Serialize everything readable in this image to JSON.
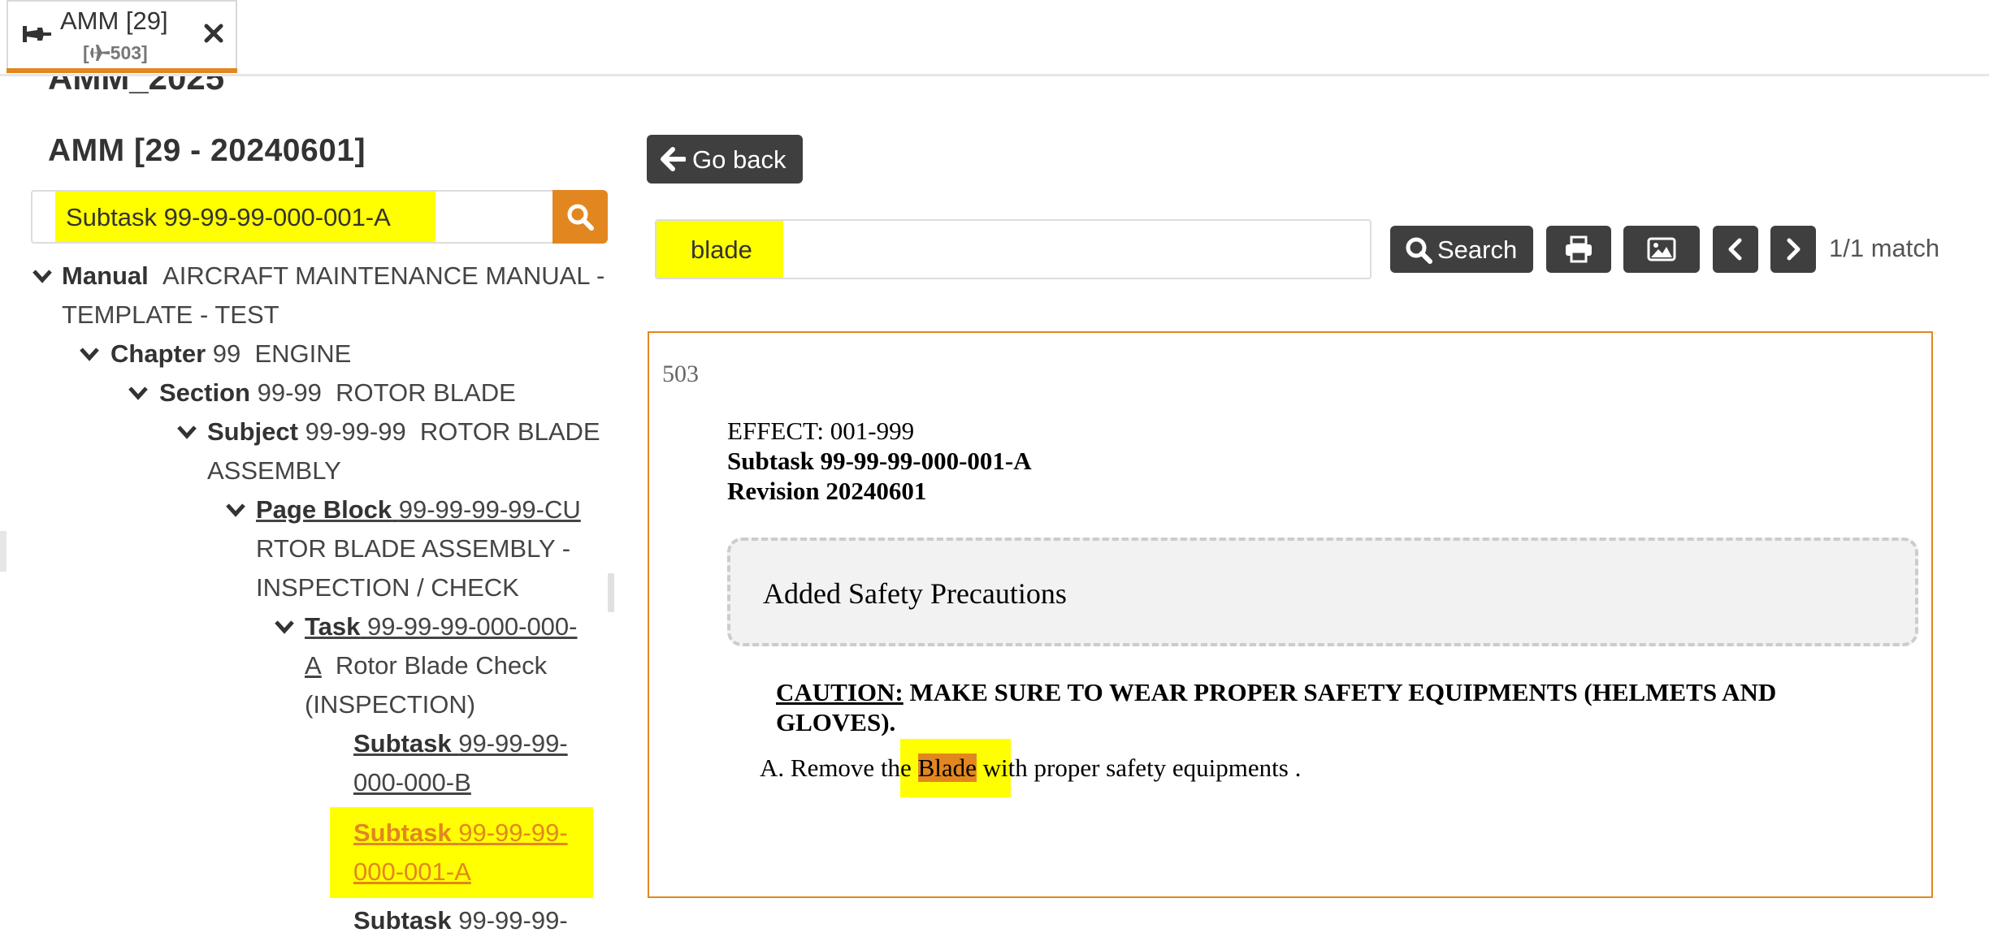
{
  "tab": {
    "title": "AMM [29]",
    "subtitle_prefix": "[",
    "subtitle_number": "503]",
    "pin_icon": "pin-icon",
    "plane_icon": "airplane-icon",
    "close_icon": "close-icon"
  },
  "colors": {
    "accent": "#e2871f",
    "highlight": "#ffff00",
    "dark_button": "#3f3f3f"
  },
  "left": {
    "doc_header": "AMM_2025",
    "doc_title": "AMM [29 - 20240601]",
    "search_value": "Subtask 99-99-99-000-001-A",
    "search_icon": "search-icon",
    "tree": {
      "manual": {
        "type": "Manual",
        "text1": "AIRCRAFT MAINTENANCE MANUAL -",
        "text2": "TEMPLATE - TEST"
      },
      "chapter": {
        "type": "Chapter",
        "code": "99",
        "name": "ENGINE"
      },
      "section": {
        "type": "Section",
        "code": "99-99",
        "name": "ROTOR BLADE"
      },
      "subject": {
        "type": "Subject",
        "code": "99-99-99",
        "name1": "ROTOR BLADE",
        "name2": "ASSEMBLY"
      },
      "pageblock": {
        "type": "Page Block",
        "code": "99-99-99-99-CU",
        "name1": "RTOR BLADE ASSEMBLY -",
        "name2": "INSPECTION / CHECK"
      },
      "task": {
        "type": "Task",
        "code1": "99-99-99-000-000-",
        "code2": "A",
        "name1": "Rotor Blade Check",
        "name2": "(INSPECTION)"
      },
      "subtask_b": {
        "type": "Subtask",
        "code1": "99-99-99-",
        "code2": "000-000-B"
      },
      "subtask_a": {
        "type": "Subtask",
        "code1": "99-99-99-",
        "code2": "000-001-A"
      },
      "subtask_next": {
        "type": "Subtask",
        "code1": "99-99-99-"
      }
    }
  },
  "right": {
    "go_back": "Go back",
    "search_value": "blade",
    "search_button": "Search",
    "match_count": "1/1 match",
    "content": {
      "page_number": "503",
      "effect": "EFFECT: 001-999",
      "subtask": "Subtask 99-99-99-000-001-A",
      "revision": "Revision 20240601",
      "safety_title": "Added Safety Precautions",
      "caution_label": "CAUTION:",
      "caution_text": "MAKE SURE TO WEAR PROPER SAFETY EQUIPMENTS (HELMETS AND GLOVES).",
      "step_prefix": "A. Remove the ",
      "step_match": "Blade",
      "step_suffix": " with proper safety equipments ."
    }
  }
}
